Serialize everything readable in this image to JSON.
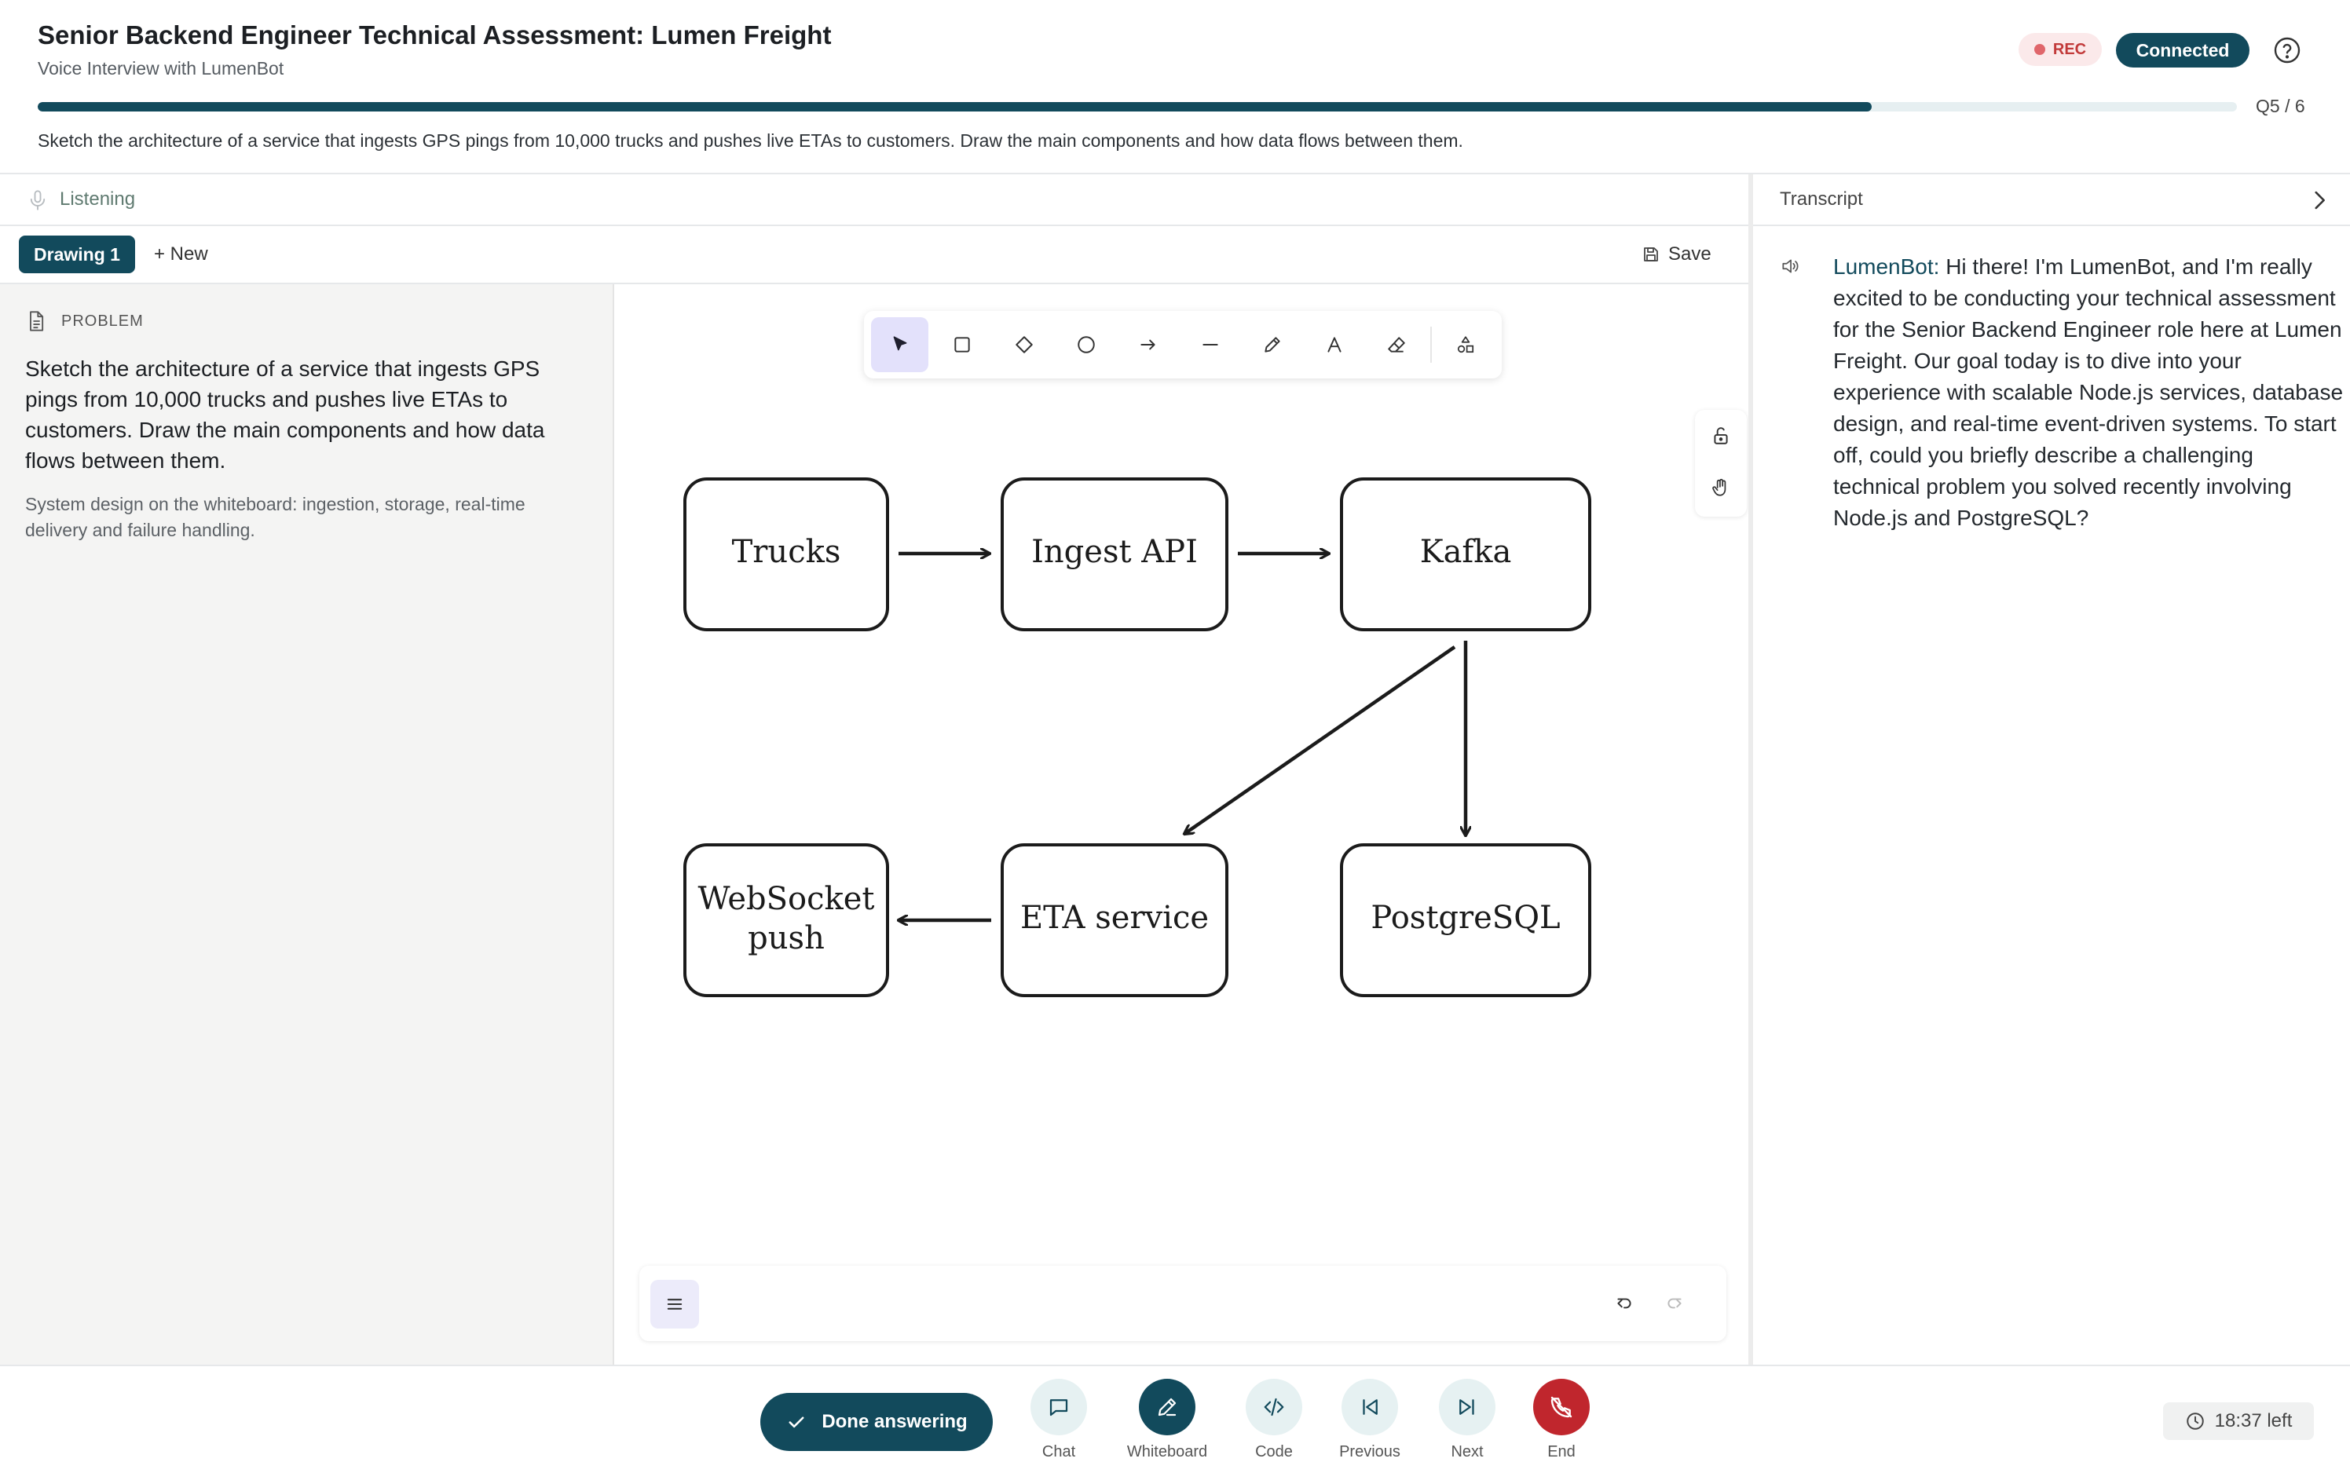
{
  "header": {
    "title": "Senior Backend Engineer Technical Assessment: Lumen Freight",
    "subtitle": "Voice Interview with LumenBot",
    "rec_label": "REC",
    "status_label": "Connected",
    "progress_label": "Q5 / 6",
    "progress_fraction": 0.834,
    "question": "Sketch the architecture of a service that ingests GPS pings from 10,000 trucks and pushes live ETAs to customers. Draw the main components and how data flows between them."
  },
  "listening": {
    "label": "Listening"
  },
  "tabs": {
    "active": "Drawing 1",
    "new": "+ New",
    "save": "Save"
  },
  "problem": {
    "heading": "PROBLEM",
    "text": "Sketch the architecture of a service that ingests GPS pings from 10,000 trucks and pushes live ETAs to customers. Draw the main components and how data flows between them.",
    "note": "System design on the whiteboard: ingestion, storage, real-time delivery and failure handling."
  },
  "toolbar": {
    "tools": [
      "select-icon",
      "rectangle-icon",
      "diamond-icon",
      "ellipse-icon",
      "arrow-icon",
      "line-icon",
      "pencil-icon",
      "text-icon",
      "eraser-icon",
      "shapes-library-icon"
    ]
  },
  "diagram": {
    "nodes": {
      "trucks": "Trucks",
      "ingest": "Ingest API",
      "kafka": "Kafka",
      "websocket_line1": "WebSocket",
      "websocket_line2": "push",
      "eta": "ETA service",
      "postgres": "PostgreSQL"
    }
  },
  "transcript": {
    "title": "Transcript",
    "messages": [
      {
        "speaker": "LumenBot:",
        "text": " Hi there! I'm LumenBot, and I'm really excited to be conducting your technical assessment for the Senior Backend Engineer role here at Lumen Freight. Our goal today is to dive into your experience with scalable Node.js services, database design, and real-time event-driven systems. To start off, could you briefly describe a challenging technical problem you solved recently involving Node.js and PostgreSQL?"
      }
    ]
  },
  "footer": {
    "done_label": "Done answering",
    "controls": {
      "chat": "Chat",
      "whiteboard": "Whiteboard",
      "code": "Code",
      "previous": "Previous",
      "next": "Next",
      "end": "End"
    },
    "time_left": "18:37 left"
  },
  "colors": {
    "brand": "#124a5c",
    "rec": "#c23a3a",
    "end": "#c0262d",
    "tool_active": "#e3e1fb"
  }
}
